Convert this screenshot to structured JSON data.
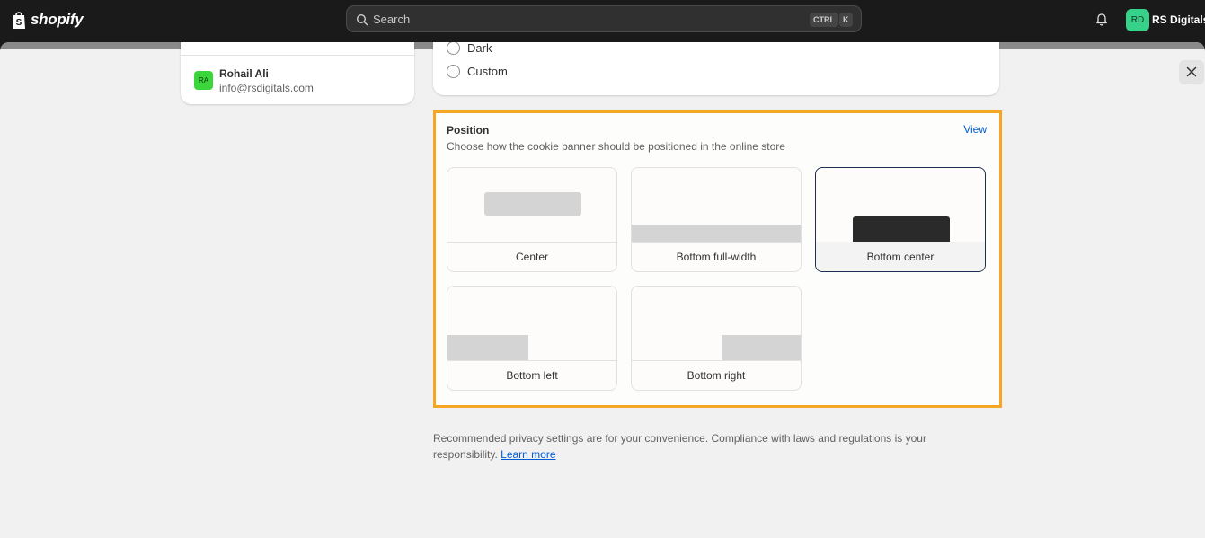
{
  "topbar": {
    "logo_text": "shopify",
    "search_placeholder": "Search",
    "shortcut_keys": [
      "CTRL",
      "K"
    ],
    "store_initials": "RD",
    "store_name": "RS Digitals"
  },
  "user": {
    "initials": "RA",
    "name": "Rohail Ali",
    "email": "info@rsdigitals.com"
  },
  "theme_options": [
    "Dark",
    "Custom"
  ],
  "position": {
    "title": "Position",
    "link_label": "View",
    "description": "Choose how the cookie banner should be positioned in the online store",
    "options": [
      {
        "label": "Center",
        "selected": false
      },
      {
        "label": "Bottom full-width",
        "selected": false
      },
      {
        "label": "Bottom center",
        "selected": true
      },
      {
        "label": "Bottom left",
        "selected": false
      },
      {
        "label": "Bottom right",
        "selected": false
      }
    ]
  },
  "footer": {
    "note": "Recommended privacy settings are for your convenience. Compliance with laws and regulations is your responsibility.",
    "link_label": "Learn more"
  },
  "colors": {
    "highlight": "#f5a623",
    "link": "#005bd3",
    "selected_border": "#1f2f52"
  },
  "icons": [
    "shopify-bag-icon",
    "search-icon",
    "bell-icon",
    "close-icon"
  ]
}
